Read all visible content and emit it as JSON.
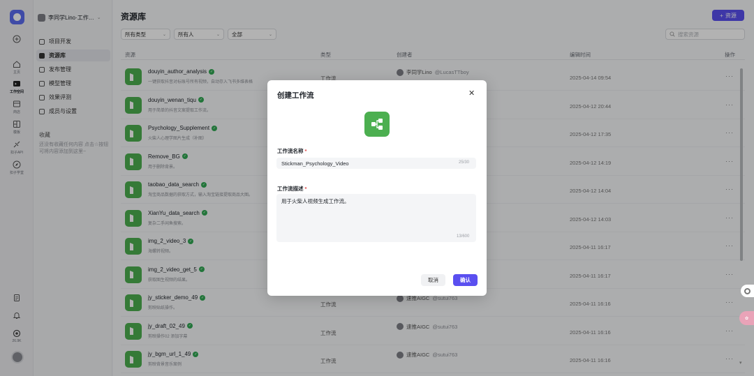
{
  "rail": {
    "items": [
      {
        "label": "主页",
        "icon": "home-icon"
      },
      {
        "label": "工作空间",
        "icon": "workspace-icon"
      },
      {
        "label": "商店",
        "icon": "store-icon"
      },
      {
        "label": "模板",
        "icon": "template-icon"
      },
      {
        "label": "扣子API",
        "icon": "api-icon"
      },
      {
        "label": "扣子学堂",
        "icon": "learn-icon"
      }
    ],
    "counter": "26.9K"
  },
  "sidebar": {
    "workspace_name": "李同学Lino·工作…",
    "items": [
      {
        "label": "项目开发"
      },
      {
        "label": "资源库"
      },
      {
        "label": "发布管理"
      },
      {
        "label": "模型管理"
      },
      {
        "label": "效果评测"
      },
      {
        "label": "成员与设置"
      }
    ],
    "favorites_title": "收藏",
    "favorites_empty": "还没有收藏任何内容 点击☆按钮可将内容添加到这里~"
  },
  "main": {
    "title": "资源库",
    "add_button": "资源",
    "filters": [
      "所有类型",
      "所有人",
      "全部"
    ],
    "search_placeholder": "搜索资源",
    "columns": {
      "resource": "资源",
      "type": "类型",
      "creator": "创建者",
      "edited": "编辑时间",
      "actions": "操作"
    },
    "rows": [
      {
        "name": "douyin_author_analysis",
        "desc": "一键获取抖音对标账号所有视频，自动存入飞书多维表格",
        "type": "工作流",
        "creator": "李同学Lino",
        "handle": "@LucasTTboy",
        "time": "2025-04-14 09:54"
      },
      {
        "name": "douyin_wenan_tiqu",
        "desc": "用于简单的抖音文案提取工作流。",
        "type": "",
        "creator": "",
        "handle": "",
        "time": "2025-04-12 20:44"
      },
      {
        "name": "Psychology_Supplement",
        "desc": "火柴人心理学图片生成（补图）",
        "type": "",
        "creator": "",
        "handle": "",
        "time": "2025-04-12 17:35"
      },
      {
        "name": "Remove_BG",
        "desc": "用于删除背景。",
        "type": "",
        "creator": "",
        "handle": "",
        "time": "2025-04-12 14:19"
      },
      {
        "name": "taobao_data_search",
        "desc": "淘宝商品数据的获取方式，输入淘宝链接提取商品大图。",
        "type": "",
        "creator": "",
        "handle": "",
        "time": "2025-04-12 14:04"
      },
      {
        "name": "XianYu_data_search",
        "desc": "复杂二手闲鱼搜索。",
        "type": "",
        "creator": "",
        "handle": "",
        "time": "2025-04-12 14:03"
      },
      {
        "name": "img_2_video_3",
        "desc": "海螺转视频。",
        "type": "",
        "creator": "",
        "handle": "",
        "time": "2025-04-11 16:17"
      },
      {
        "name": "img_2_video_get_5",
        "desc": "获取图生视频的结果。",
        "type": "",
        "creator": "",
        "handle": "",
        "time": "2025-04-11 16:17"
      },
      {
        "name": "jy_sticker_demo_49",
        "desc": "剪映贴纸操作。",
        "type": "工作流",
        "creator": "速推AIGC",
        "handle": "@sutui763",
        "time": "2025-04-11 16:16"
      },
      {
        "name": "jy_draft_02_49",
        "desc": "剪映操作02 添加字幕",
        "type": "工作流",
        "creator": "速推AIGC",
        "handle": "@sutui763",
        "time": "2025-04-11 16:16"
      },
      {
        "name": "jy_bgm_url_1_49",
        "desc": "剪映背景音乐案例",
        "type": "工作流",
        "creator": "速推AIGC",
        "handle": "@sutui763",
        "time": "2025-04-11 16:16"
      }
    ]
  },
  "modal": {
    "title": "创建工作流",
    "name_label": "工作流名称",
    "name_value": "Stickman_Psychology_Video",
    "name_count": "25/30",
    "desc_label": "工作流描述",
    "desc_value": "用于火柴人视频生成工作流。",
    "desc_count": "13/600",
    "cancel": "取消",
    "confirm": "确认"
  },
  "colors": {
    "accent": "#5a4ff0",
    "workflow_green": "#4caf50",
    "verified": "#31a853",
    "required": "#e04848"
  }
}
